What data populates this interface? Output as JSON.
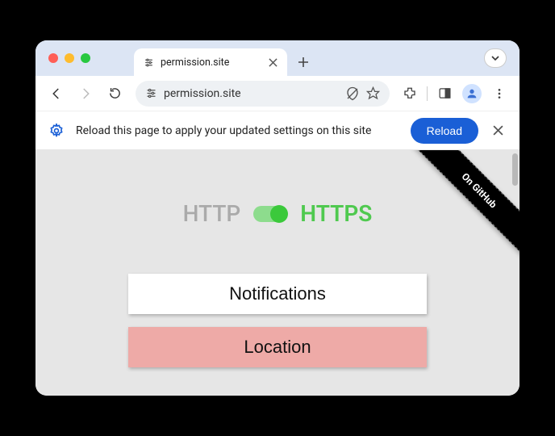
{
  "tab": {
    "title": "permission.site"
  },
  "address": {
    "url": "permission.site"
  },
  "infobar": {
    "message": "Reload this page to apply your updated settings on this site",
    "button_label": "Reload"
  },
  "content": {
    "github_ribbon": "On GitHub",
    "protocol_off": "HTTP",
    "protocol_on": "HTTPS",
    "buttons": {
      "notifications": "Notifications",
      "location": "Location"
    }
  }
}
